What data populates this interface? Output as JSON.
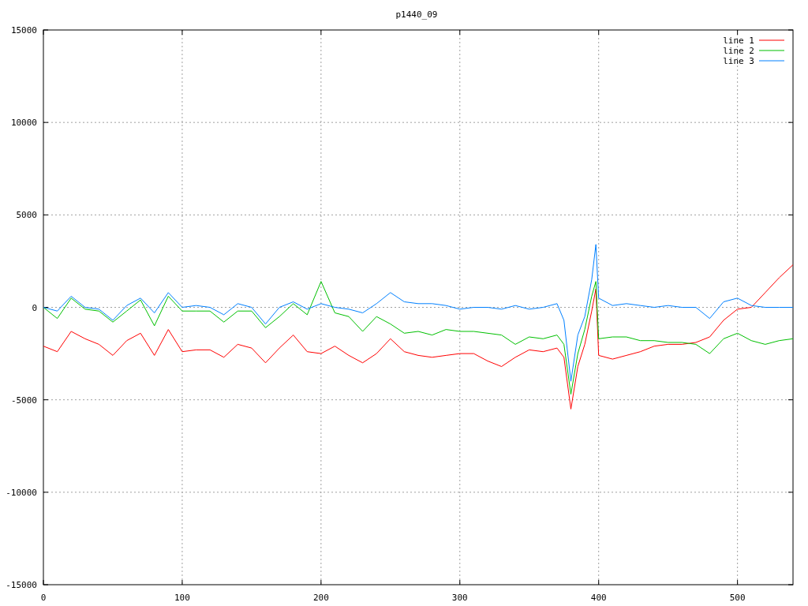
{
  "chart_data": {
    "type": "line",
    "title": "p1440_09",
    "xlim": [
      0,
      540
    ],
    "ylim": [
      -15000,
      15000
    ],
    "xticks": [
      0,
      100,
      200,
      300,
      400,
      500
    ],
    "yticks": [
      -15000,
      -10000,
      -5000,
      0,
      5000,
      10000,
      15000
    ],
    "grid": true,
    "legend": true,
    "x": [
      0,
      10,
      20,
      30,
      40,
      50,
      60,
      70,
      80,
      90,
      100,
      110,
      120,
      130,
      140,
      150,
      160,
      170,
      180,
      190,
      200,
      210,
      220,
      230,
      240,
      250,
      260,
      270,
      280,
      290,
      300,
      310,
      320,
      330,
      340,
      350,
      360,
      370,
      375,
      380,
      385,
      390,
      395,
      398,
      400,
      410,
      420,
      430,
      440,
      450,
      460,
      470,
      480,
      490,
      500,
      510,
      520,
      530,
      540
    ],
    "series": [
      {
        "name": "line 1",
        "color": "#ff0000",
        "values": [
          -2100,
          -2400,
          -1300,
          -1700,
          -2000,
          -2600,
          -1800,
          -1400,
          -2600,
          -1200,
          -2400,
          -2300,
          -2300,
          -2700,
          -2000,
          -2200,
          -3000,
          -2200,
          -1500,
          -2400,
          -2500,
          -2100,
          -2600,
          -3000,
          -2500,
          -1700,
          -2400,
          -2600,
          -2700,
          -2600,
          -2500,
          -2500,
          -2900,
          -3200,
          -2700,
          -2300,
          -2400,
          -2200,
          -2700,
          -5500,
          -3200,
          -2000,
          -200,
          1000,
          -2600,
          -2800,
          -2600,
          -2400,
          -2100,
          -2000,
          -2000,
          -1900,
          -1600,
          -700,
          -100,
          0,
          800,
          1600,
          2300
        ]
      },
      {
        "name": "line 2",
        "color": "#00c000",
        "values": [
          0,
          -600,
          500,
          -100,
          -200,
          -800,
          -200,
          400,
          -1000,
          600,
          -200,
          -200,
          -200,
          -800,
          -200,
          -200,
          -1100,
          -500,
          200,
          -400,
          1400,
          -300,
          -500,
          -1300,
          -500,
          -900,
          -1400,
          -1300,
          -1500,
          -1200,
          -1300,
          -1300,
          -1400,
          -1500,
          -2000,
          -1600,
          -1700,
          -1500,
          -2000,
          -4700,
          -2500,
          -1200,
          600,
          1400,
          -1700,
          -1600,
          -1600,
          -1800,
          -1800,
          -1900,
          -1900,
          -2000,
          -2500,
          -1700,
          -1400,
          -1800,
          -2000,
          -1800,
          -1700
        ]
      },
      {
        "name": "line 3",
        "color": "#0080ff",
        "values": [
          0,
          -200,
          600,
          0,
          -100,
          -700,
          100,
          500,
          -300,
          800,
          0,
          100,
          0,
          -400,
          200,
          0,
          -900,
          0,
          300,
          -100,
          200,
          0,
          -100,
          -300,
          200,
          800,
          300,
          200,
          200,
          100,
          -100,
          0,
          0,
          -100,
          100,
          -100,
          0,
          200,
          -700,
          -4000,
          -1500,
          -500,
          1500,
          3400,
          500,
          100,
          200,
          100,
          0,
          100,
          0,
          0,
          -600,
          300,
          500,
          100,
          0,
          0,
          0
        ]
      }
    ]
  }
}
